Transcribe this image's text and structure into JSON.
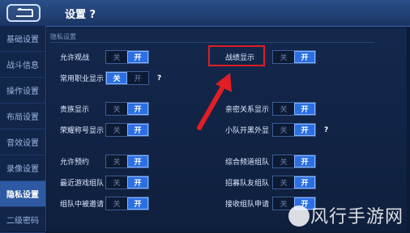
{
  "header": {
    "title": "设置 ?"
  },
  "sidebar": {
    "items": [
      {
        "label": "基础设置",
        "active": false
      },
      {
        "label": "战斗信息",
        "active": false
      },
      {
        "label": "操作设置",
        "active": false
      },
      {
        "label": "布局设置",
        "active": false
      },
      {
        "label": "音效设置",
        "active": false
      },
      {
        "label": "录像设置",
        "active": false
      },
      {
        "label": "隐私设置",
        "active": true
      },
      {
        "label": "二级密码",
        "active": false
      }
    ]
  },
  "section": {
    "label": "隐私设置"
  },
  "toggle_labels": {
    "off": "关",
    "on": "开"
  },
  "help": "?",
  "settings": {
    "allow_spectate": {
      "label": "允许观战",
      "state": "on"
    },
    "battle_record_display": {
      "label": "战绩显示",
      "state": "on"
    },
    "common_role_display": {
      "label": "常用职业显示",
      "state": "off"
    },
    "noble_display": {
      "label": "贵族显示",
      "state": "on"
    },
    "relationship_display": {
      "label": "亲密关系显示",
      "state": "on"
    },
    "honor_title_display": {
      "label": "荣耀称号显示",
      "state": "on"
    },
    "team_open_black": {
      "label": "小队开黑外显",
      "state": "on"
    },
    "allow_reservation": {
      "label": "允许预约",
      "state": "on"
    },
    "general_channel_team": {
      "label": "综合频道组队",
      "state": "on"
    },
    "recent_game_team": {
      "label": "最近游戏组队",
      "state": "on"
    },
    "recruit_friend_team": {
      "label": "招募队友组队",
      "state": "on"
    },
    "team_invited": {
      "label": "组队中被邀请",
      "state": "on"
    },
    "receive_team_request": {
      "label": "接收组队申请",
      "state": "on"
    }
  },
  "watermark": "风行手游网",
  "colors": {
    "accent": "#2b6fe2",
    "highlight": "#e01e24"
  }
}
